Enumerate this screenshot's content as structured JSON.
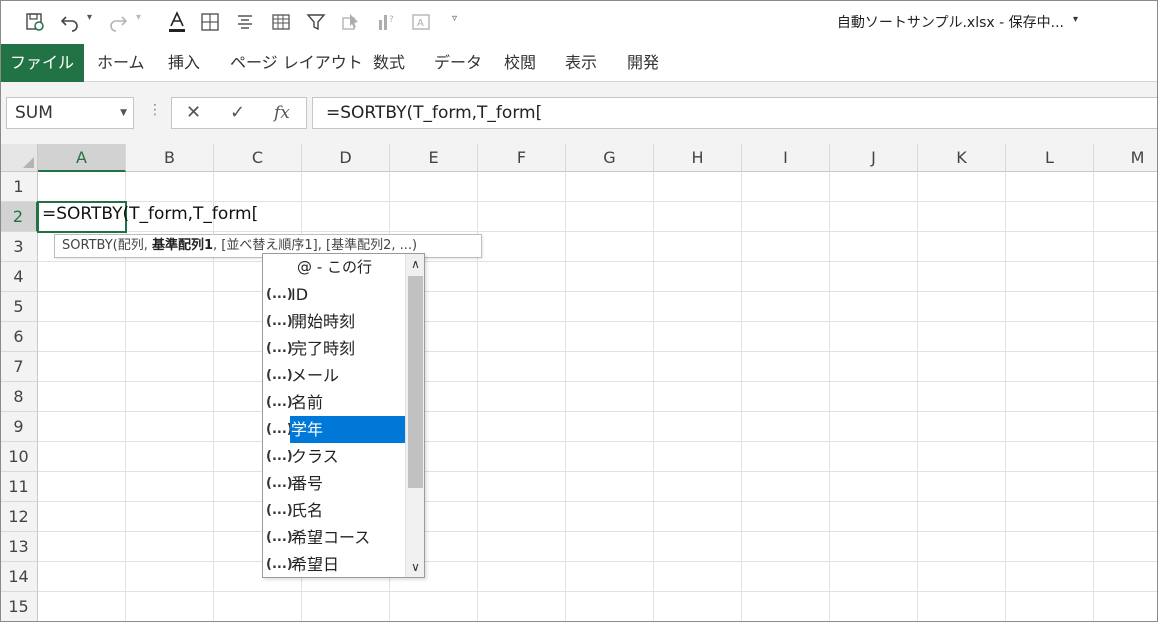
{
  "qat": {
    "title": "自動ソートサンプル.xlsx  -  保存中...",
    "icons": [
      "save-autosave-icon",
      "undo-icon",
      "redo-icon",
      "font-color-icon",
      "borders-icon",
      "align-icon",
      "table-icon",
      "filter-icon",
      "select-objects-icon",
      "chart-icon",
      "textbox-icon",
      "customize-qat-icon"
    ]
  },
  "tabs": {
    "file": "ファイル",
    "home": "ホーム",
    "insert": "挿入",
    "layout": "ページ レイアウト",
    "formulas": "数式",
    "data": "データ",
    "review": "校閲",
    "view": "表示",
    "developer": "開発"
  },
  "formula_bar": {
    "name_box": "SUM",
    "fx": "fx",
    "formula": "=SORTBY(T_form,T_form["
  },
  "grid": {
    "columns": [
      "A",
      "B",
      "C",
      "D",
      "E",
      "F",
      "G",
      "H",
      "I",
      "J",
      "K",
      "L",
      "M"
    ],
    "rows": [
      "1",
      "2",
      "3",
      "4",
      "5",
      "6",
      "7",
      "8",
      "9",
      "10",
      "11",
      "12",
      "13",
      "14",
      "15"
    ],
    "active_column": "A",
    "active_row": "2",
    "cell_a2": "=SORTBY(T_form,T_form["
  },
  "tooltip": {
    "func": "SORTBY(配列, ",
    "bold_arg": "基準配列1",
    "rest": ", [並べ替え順序1], [基準配列2, ...)"
  },
  "dropdown": {
    "header": "@ - この行",
    "icon_text": "(...)",
    "items": [
      "ID",
      "開始時刻",
      "完了時刻",
      "メール",
      "名前",
      "学年",
      "クラス",
      "番号",
      "氏名",
      "希望コース",
      "希望日"
    ],
    "selected_index": 5
  },
  "colors": {
    "excel_green": "#217346",
    "selection_blue": "#0078d7"
  }
}
